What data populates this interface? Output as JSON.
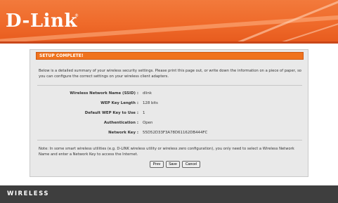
{
  "brand": {
    "name": "D-Link",
    "registered_mark": "®"
  },
  "panel": {
    "title": "SETUP COMPLETE!",
    "intro": "Below is a detailed summary of your wireless security settings. Please print this page out, or write down the information on a piece of paper, so you can configure the correct settings on your wireless client adapters.",
    "settings": [
      {
        "label": "Wireless Network Name (SSID) :",
        "value": "dlink"
      },
      {
        "label": "WEP Key Length :",
        "value": "128 bits"
      },
      {
        "label": "Default WEP Key to Use :",
        "value": "1"
      },
      {
        "label": "Authentication :",
        "value": "Open"
      },
      {
        "label": "Network Key :",
        "value": "55D52D33F3A78D61162DB444FC"
      }
    ],
    "note": "Note: In some smart wireless utilities (e.g. D-LINK wireless utility or wireless zero configuration), you only need to select a Wireless Network Name and enter a Network Key to access the Internet.",
    "buttons": {
      "prev": "Prev",
      "save": "Save",
      "cancel": "Cancel"
    }
  },
  "footer": {
    "label": "WIRELESS"
  },
  "colors": {
    "header_orange": "#ef6a2a",
    "title_bar": "#f0731e",
    "footer_bg": "#3e3e3e",
    "panel_bg": "#e9e9e9"
  }
}
